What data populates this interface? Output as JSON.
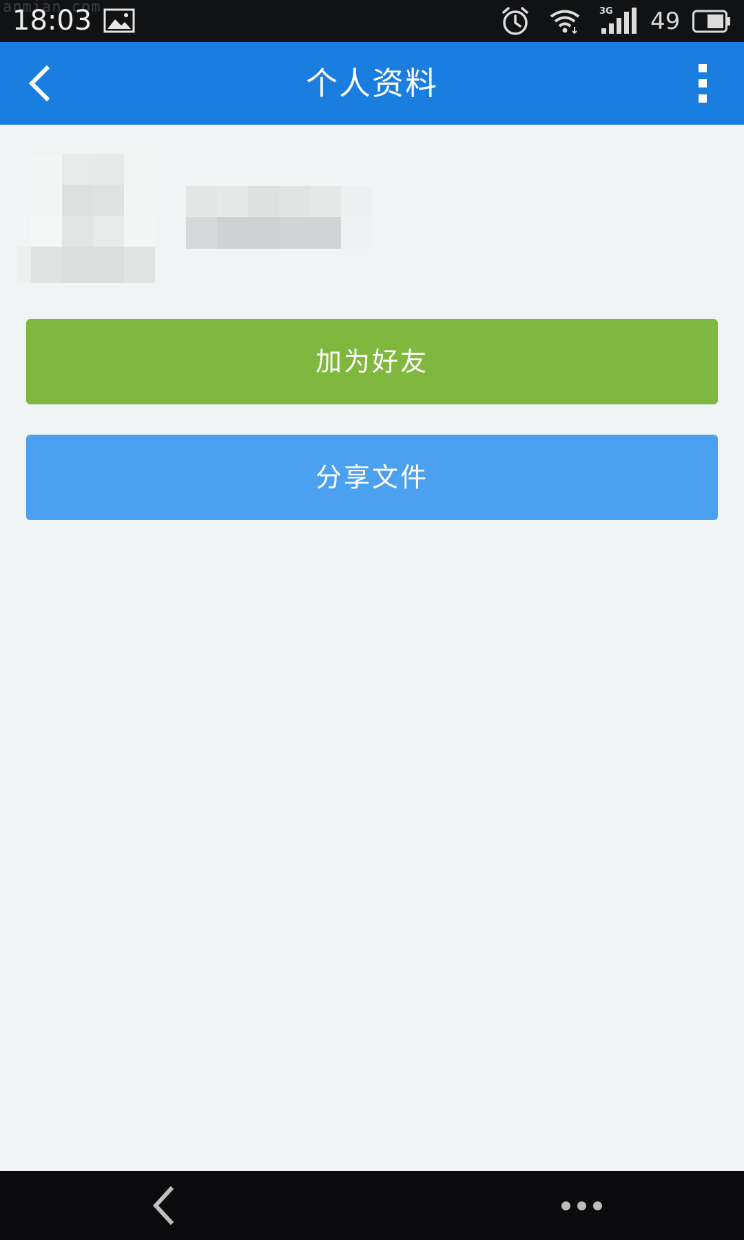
{
  "status_bar": {
    "time": "18:03",
    "network_type": "3G",
    "battery_level": "49",
    "watermark": "anmian.com",
    "icons": [
      "image-icon",
      "alarm-icon",
      "wifi-icon",
      "signal-icon",
      "battery-icon"
    ]
  },
  "app_bar": {
    "title": "个人资料",
    "back_icon": "chevron-left-icon",
    "more_icon": "more-vertical-icon"
  },
  "profile": {
    "avatar_icon": "avatar",
    "name_redacted": true
  },
  "actions": {
    "add_friend_label": "加为好友",
    "share_file_label": "分享文件"
  },
  "colors": {
    "app_bar": "#1a7de0",
    "add_friend": "#80b83f",
    "share_file": "#4ba0f0",
    "background": "#f0f4f4",
    "status_bar": "#111214",
    "nav_bar": "#0b0b0d"
  },
  "nav_bar": {
    "back_icon": "chevron-left-icon",
    "menu_icon": "more-horizontal-icon"
  }
}
